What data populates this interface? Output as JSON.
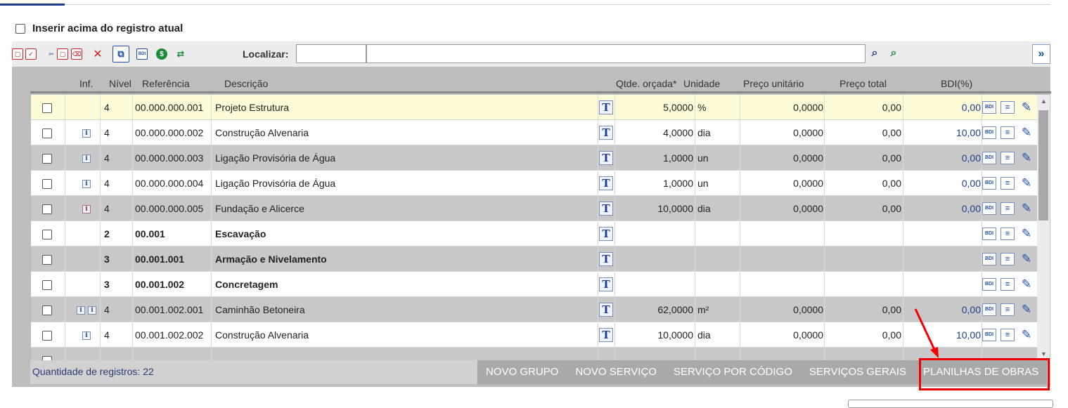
{
  "options": {
    "insert_above_label": "Inserir acima do registro atual"
  },
  "toolbar": {
    "find_label": "Localizar:"
  },
  "columns": [
    "Inf.",
    "Nível",
    "Referência",
    "Descrição",
    "Qtde. orçada*",
    "Unidade",
    "Preço unitário",
    "Preço total",
    "BDI(%)"
  ],
  "rows": [
    {
      "style": "yellow",
      "info": 0,
      "level": "4",
      "ref": "00.000.000.001",
      "desc": "Projeto Estrutura",
      "qty": "5,0000",
      "unit": "%",
      "unit_price": "0,0000",
      "total": "0,00",
      "bdi": "0,00"
    },
    {
      "style": "white",
      "info": 1,
      "level": "4",
      "ref": "00.000.000.002",
      "desc": "Construção Alvenaria",
      "qty": "4,0000",
      "unit": "dia",
      "unit_price": "0,0000",
      "total": "0,00",
      "bdi": "10,00"
    },
    {
      "style": "gray",
      "info": 1,
      "level": "4",
      "ref": "00.000.000.003",
      "desc": "Ligação Provisória de Água",
      "qty": "1,0000",
      "unit": "un",
      "unit_price": "0,0000",
      "total": "0,00",
      "bdi": "0,00"
    },
    {
      "style": "white",
      "info": 1,
      "level": "4",
      "ref": "00.000.000.004",
      "desc": "Ligação Provisória de Água",
      "qty": "1,0000",
      "unit": "un",
      "unit_price": "0,0000",
      "total": "0,00",
      "bdi": "0,00"
    },
    {
      "style": "gray",
      "info": 1,
      "info_red": true,
      "level": "4",
      "ref": "00.000.000.005",
      "desc": "Fundação e Alicerce",
      "qty": "10,0000",
      "unit": "dia",
      "unit_price": "0,0000",
      "total": "0,00",
      "bdi": "0,00"
    },
    {
      "style": "white",
      "bold": true,
      "info": 0,
      "level": "2",
      "ref": "00.001",
      "desc": "Escavação",
      "qty": "",
      "unit": "",
      "unit_price": "",
      "total": "",
      "bdi": ""
    },
    {
      "style": "gray",
      "bold": true,
      "info": 0,
      "level": "3",
      "ref": "00.001.001",
      "desc": "Armação e Nivelamento",
      "qty": "",
      "unit": "",
      "unit_price": "",
      "total": "",
      "bdi": ""
    },
    {
      "style": "white",
      "bold": true,
      "info": 0,
      "level": "3",
      "ref": "00.001.002",
      "desc": "Concretagem",
      "qty": "",
      "unit": "",
      "unit_price": "",
      "total": "",
      "bdi": ""
    },
    {
      "style": "gray",
      "info": 2,
      "level": "4",
      "ref": "00.001.002.001",
      "desc": "Caminhão Betoneira",
      "qty": "62,0000",
      "unit": "m²",
      "unit_price": "0,0000",
      "total": "0,00",
      "bdi": "0,00"
    },
    {
      "style": "white",
      "info": 1,
      "level": "4",
      "ref": "00.001.002.002",
      "desc": "Construção Alvenaria",
      "qty": "10,0000",
      "unit": "dia",
      "unit_price": "0,0000",
      "total": "0,00",
      "bdi": "10,00"
    },
    {
      "style": "gray",
      "info": 0,
      "level": "",
      "ref": "",
      "desc": "",
      "qty": "",
      "unit": "",
      "unit_price": "",
      "total": "",
      "bdi": ""
    }
  ],
  "row_icons": {
    "text_btn": "T",
    "bdi_btn": "BDI",
    "list_btn": "≡",
    "edit_btn": "✎",
    "info_glyph": "i"
  },
  "footer": {
    "count_label": "Quantidade de registros: ",
    "count_value": "22",
    "buttons": [
      "NOVO GRUPO",
      "NOVO SERVIÇO",
      "SERVIÇO POR CÓDIGO",
      "SERVIÇOS GERAIS",
      "PLANILHAS DE OBRAS"
    ]
  },
  "annotation": {
    "color": "#f00000"
  }
}
